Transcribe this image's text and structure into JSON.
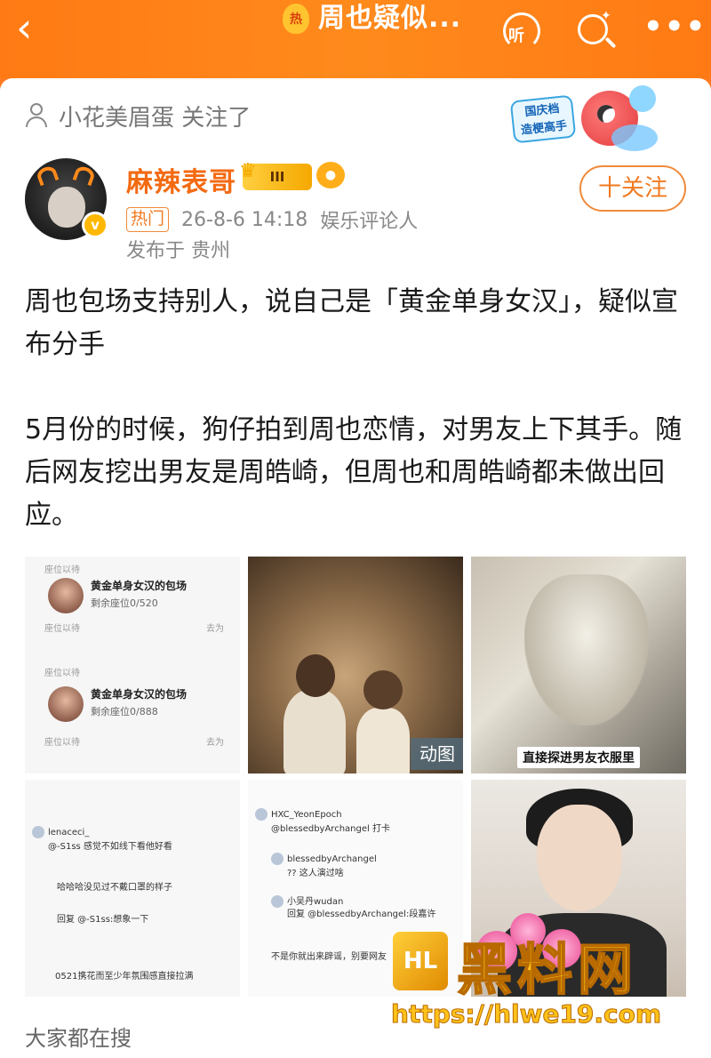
{
  "topbar": {
    "hot_badge": "热",
    "title": "周也疑似...",
    "listen_label": "听"
  },
  "follow_notice": "小花美眉蛋 关注了",
  "promo": {
    "line1": "国庆档",
    "line2": "造梗高手"
  },
  "author": {
    "name": "麻辣表哥",
    "level": "III",
    "verified": "v",
    "follow_button": "十关注",
    "hot_tag": "热门",
    "time": "26-8-6 14:18",
    "role": "娱乐评论人",
    "location": "发布于 贵州"
  },
  "post": {
    "paragraphs": [
      "周也包场支持别人，说自己是「黄金单身女汉」，疑似宣布分手",
      "5月份的时候，狗仔拍到周也恋情，对男友上下其手。随后网友挖出男友是周皓崎，但周也和周皓崎都未做出回应。"
    ]
  },
  "images": {
    "tile1": {
      "card1_title": "黄金单身女汉的包场",
      "card1_sub": "剩余座位0/520",
      "card2_title": "黄金单身女汉的包场",
      "card2_sub": "剩余座位0/888",
      "row_label": "座位以待",
      "go_label": "去为"
    },
    "tile2": {
      "badge": "动图"
    },
    "tile3": {
      "caption": "直接探进男友衣服里"
    },
    "tile4": {
      "c1": "lenaceci_",
      "c2": "@-S1ss 感觉不如线下看他好看",
      "c3": "哈哈哈没见过不戴口罩的样子",
      "c4": "回复 @-S1ss:想象一下",
      "c5": "0521携花而至少年氛围感直接拉满"
    },
    "tile5": {
      "c1": "HXC_YeonEpoch",
      "c2": "@blessedbyArchangel 打卡",
      "c3": "blessedbyArchangel",
      "c4": "?? 这人演过啥",
      "c5": "小吴丹wudan",
      "c6": "回复 @blessedbyArchangel:段嘉许",
      "c7": "不是你就出来辟谣，别要网友"
    }
  },
  "watermark": {
    "logo": "HL",
    "title": "黑料网",
    "url": "https://hlwe19.com"
  },
  "footer": {
    "everyone_search": "大家都在搜"
  },
  "colors": {
    "brand_orange": "#ff7a14",
    "accent": "#f07a20"
  }
}
